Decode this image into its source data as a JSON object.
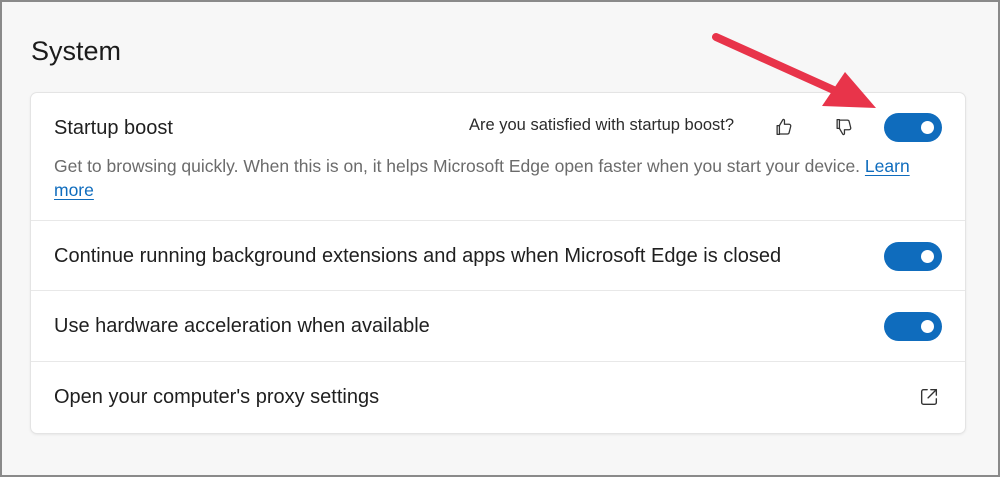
{
  "section": {
    "title": "System"
  },
  "startup_boost": {
    "label": "Startup boost",
    "feedback_question": "Are you satisfied with startup boost?",
    "description": "Get to browsing quickly. When this is on, it helps Microsoft Edge open faster when you start your device.",
    "learn_more": "Learn more",
    "enabled": true
  },
  "background_extensions": {
    "label": "Continue running background extensions and apps when Microsoft Edge is closed",
    "enabled": true
  },
  "hardware_acceleration": {
    "label": "Use hardware acceleration when available",
    "enabled": true
  },
  "proxy_settings": {
    "label": "Open your computer's proxy settings"
  },
  "icons": {
    "thumbs_up": "thumbs-up-icon",
    "thumbs_down": "thumbs-down-icon",
    "external_link": "external-link-icon"
  },
  "colors": {
    "accent": "#0f6cbd",
    "annotation_arrow": "#e8344a"
  }
}
